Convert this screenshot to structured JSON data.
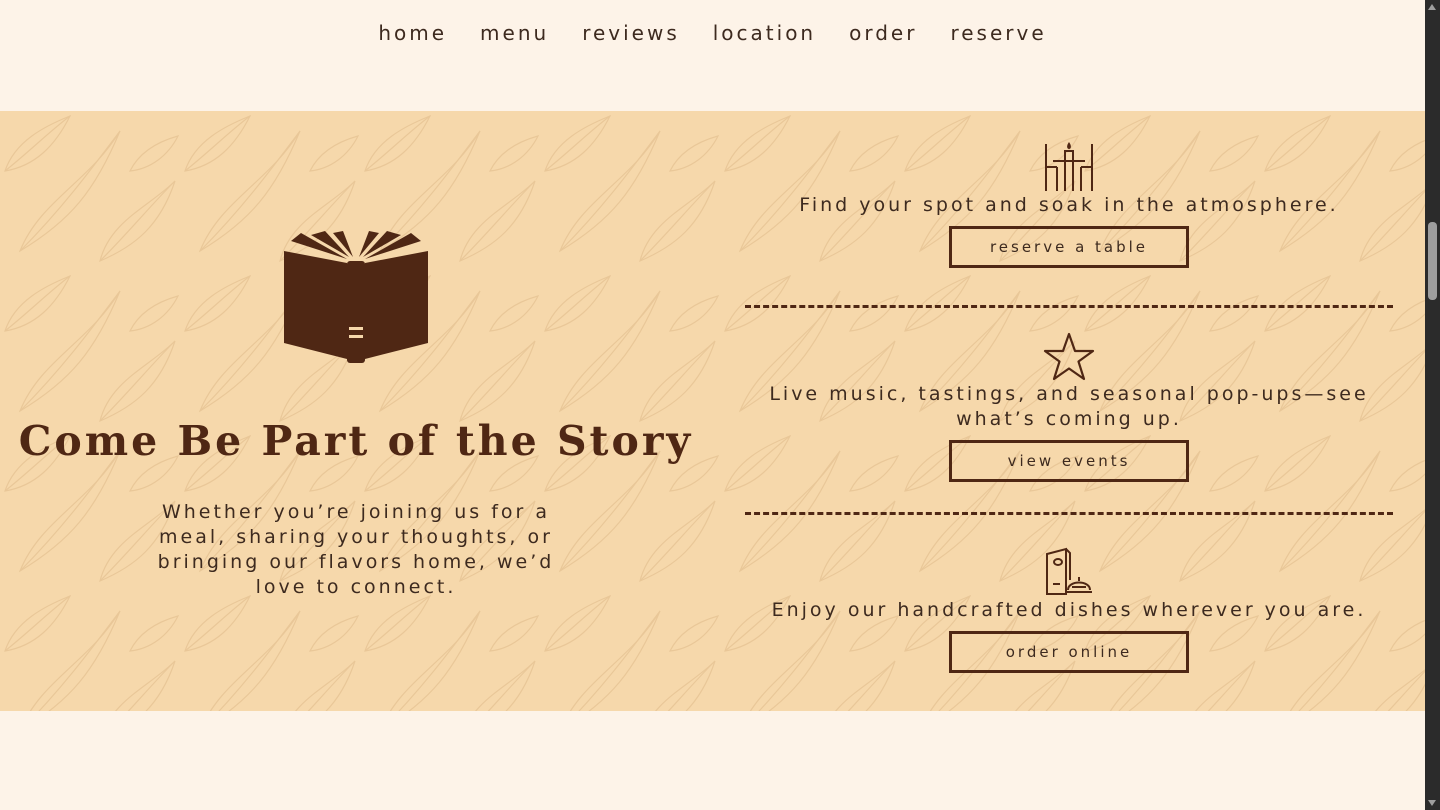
{
  "nav": {
    "items": [
      {
        "label": "home"
      },
      {
        "label": "menu"
      },
      {
        "label": "reviews"
      },
      {
        "label": "location"
      },
      {
        "label": "order"
      },
      {
        "label": "reserve"
      }
    ]
  },
  "hero": {
    "icon": "open-book-icon",
    "title": "Come Be Part of the Story",
    "subtitle": "Whether you’re joining us for a meal, sharing your thoughts, or bringing our flavors home, we’d love to connect."
  },
  "features": [
    {
      "icon": "candle-table-icon",
      "text": "Find your spot and soak in the atmosphere.",
      "button": "reserve a table"
    },
    {
      "icon": "star-icon",
      "text": "Live music, tastings, and seasonal pop-ups—see what’s coming up.",
      "button": "view events"
    },
    {
      "icon": "menu-cloche-icon",
      "text": "Enjoy our handcrafted dishes wherever you are.",
      "button": "order online"
    }
  ],
  "colors": {
    "page_bg": "#fdf3e8",
    "hero_bg": "#f6d8ab",
    "accent_brown": "#4f2714",
    "text": "#3d2a1f"
  }
}
